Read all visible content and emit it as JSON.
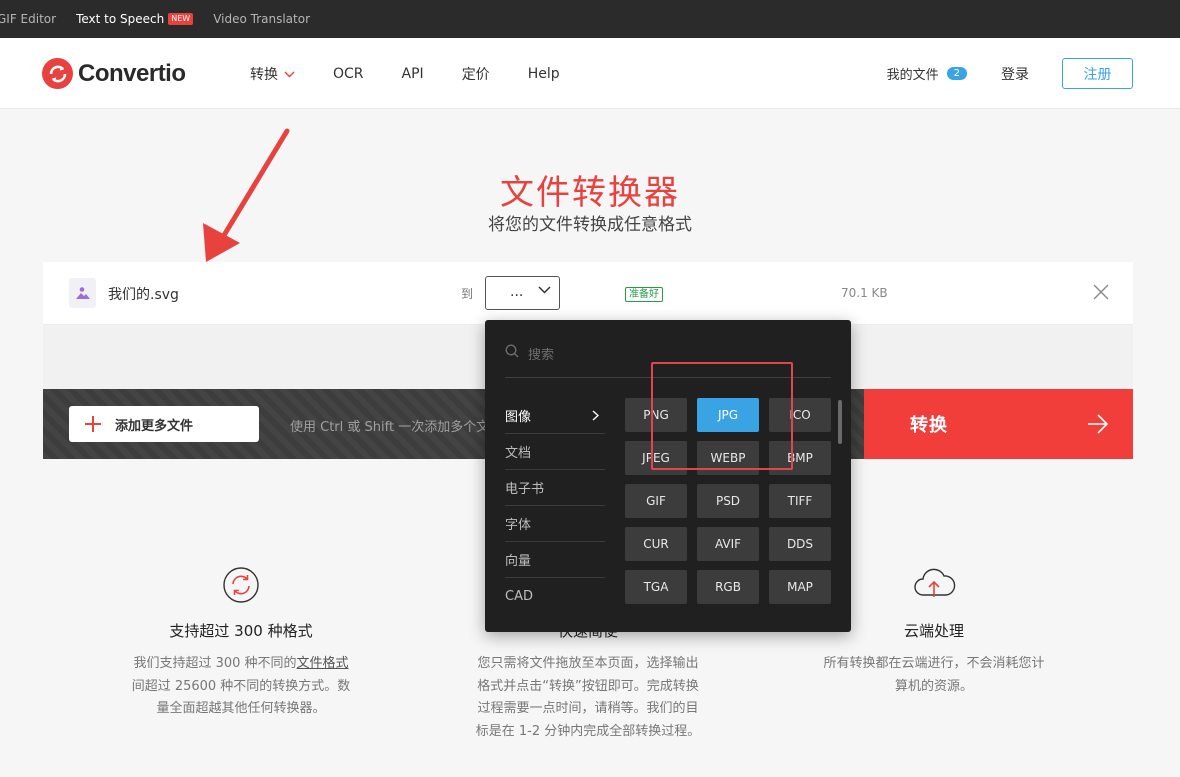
{
  "topbar": {
    "links": [
      "GIF Editor",
      "Text to Speech",
      "Video Translator"
    ],
    "new_badge": "NEW"
  },
  "header": {
    "logo": "Convertio",
    "nav": [
      "转换",
      "OCR",
      "API",
      "定价",
      "Help"
    ],
    "my_files_label": "我的文件",
    "my_files_count": "2",
    "login": "登录",
    "signup": "注册"
  },
  "hero": {
    "title": "文件转换器",
    "subtitle": "将您的文件转换成任意格式"
  },
  "file": {
    "name": "我们的.svg",
    "to_label": "到",
    "format_value": "...",
    "status": "准备好",
    "size": "70.1 KB"
  },
  "actions": {
    "add_more": "添加更多文件",
    "hint": "使用 Ctrl 或 Shift 一次添加多个文件",
    "convert": "转换"
  },
  "dropdown": {
    "search_placeholder": "搜索",
    "categories": [
      "图像",
      "文档",
      "电子书",
      "字体",
      "向量",
      "CAD"
    ],
    "active_category": "图像",
    "formats": [
      "PNG",
      "JPG",
      "ICO",
      "JPEG",
      "WEBP",
      "BMP",
      "GIF",
      "PSD",
      "TIFF",
      "CUR",
      "AVIF",
      "DDS",
      "TGA",
      "RGB",
      "MAP"
    ],
    "selected_format": "JPG"
  },
  "features": [
    {
      "icon": "refresh-icon",
      "title": "支持超过 300 种格式",
      "desc_lines": [
        "我们支持超过 300 种不同的",
        "文件格式",
        "间超过 25600 种不同的转换方式。数",
        "量全面超越其他任何转换器。"
      ]
    },
    {
      "icon": "pointer-icon",
      "title": "快速简便",
      "desc_lines": [
        "您只需将文件拖放至本页面，选择输出",
        "格式并点击“转换”按钮即可。完成转换",
        "过程需要一点时间，请稍等。我们的目",
        "标是在 1-2 分钟内完成全部转换过程。"
      ]
    },
    {
      "icon": "cloud-upload-icon",
      "title": "云端处理",
      "desc_lines": [
        "所有转换都在云端进行，不会消耗您计",
        "算机的资源。"
      ]
    }
  ],
  "colors": {
    "brand_red": "#e8423f",
    "accent_blue": "#3aa3e3",
    "dropdown_bg": "#202020",
    "annotation_red": "#e04848"
  }
}
